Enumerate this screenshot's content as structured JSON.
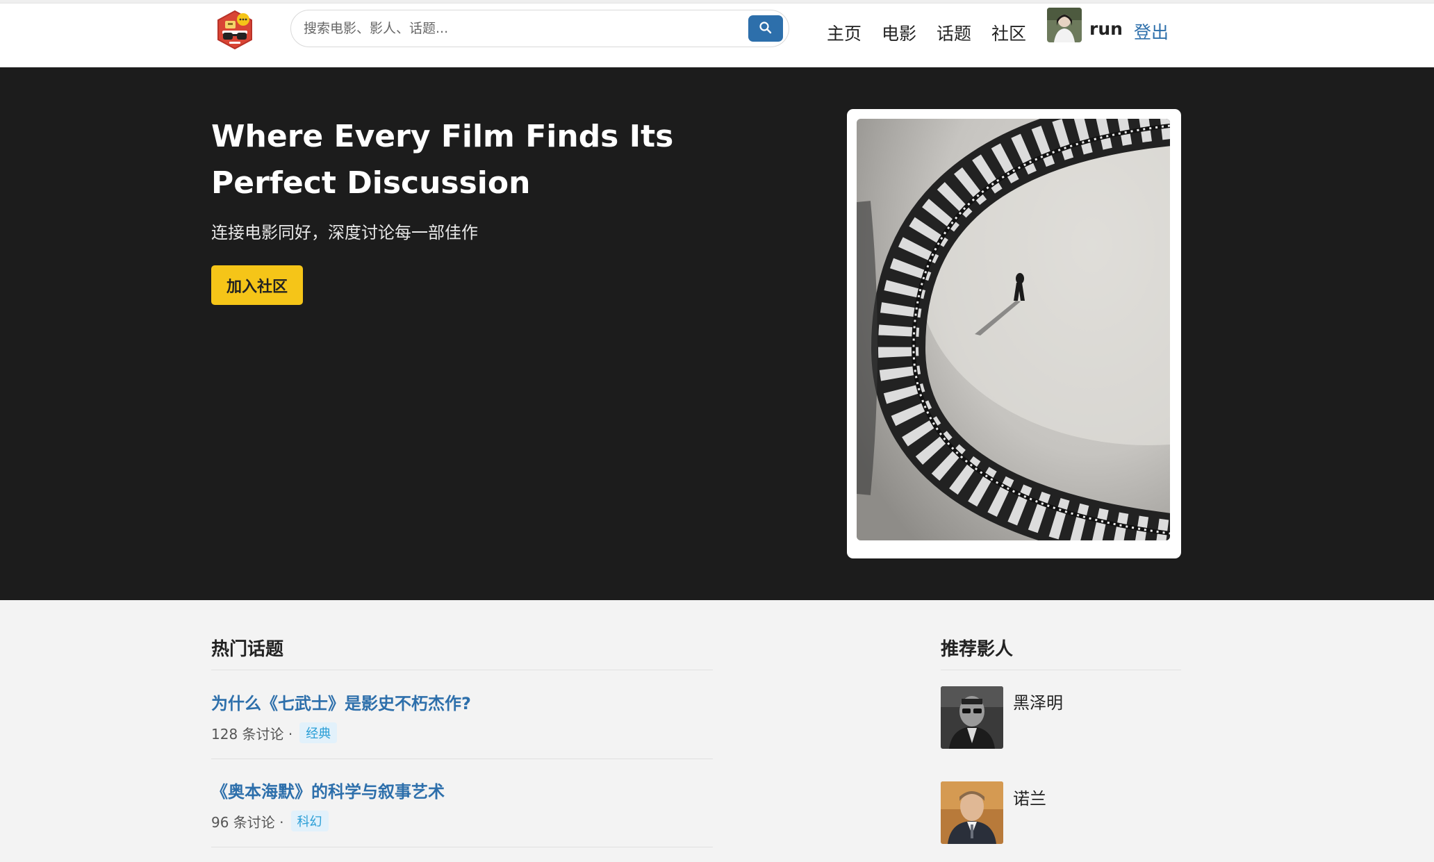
{
  "header": {
    "logo_icon": "movie-chat-glasses-icon",
    "search": {
      "placeholder": "搜索电影、影人、话题...",
      "icon": "search-icon"
    },
    "nav": [
      "主页",
      "电影",
      "话题",
      "社区"
    ],
    "user": {
      "name": "run",
      "logout_label": "登出"
    }
  },
  "hero": {
    "title": "Where Every Film Finds Its Perfect Discussion",
    "subtitle": "连接电影同好，深度讨论每一部佳作",
    "cta_label": "加入社区"
  },
  "hot_topics": {
    "title": "热门话题",
    "items": [
      {
        "title": "为什么《七武士》是影史不朽杰作?",
        "count": "128 条讨论 ·",
        "tag": "经典"
      },
      {
        "title": "《奥本海默》的科学与叙事艺术",
        "count": "96 条讨论 ·",
        "tag": "科幻"
      }
    ]
  },
  "recommended_people": {
    "title": "推荐影人",
    "items": [
      {
        "name": "黑泽明"
      },
      {
        "name": "诺兰"
      }
    ]
  },
  "colors": {
    "brand_blue": "#2d6fab",
    "accent_yellow": "#f5c518",
    "hero_bg": "#1c1c1c"
  }
}
